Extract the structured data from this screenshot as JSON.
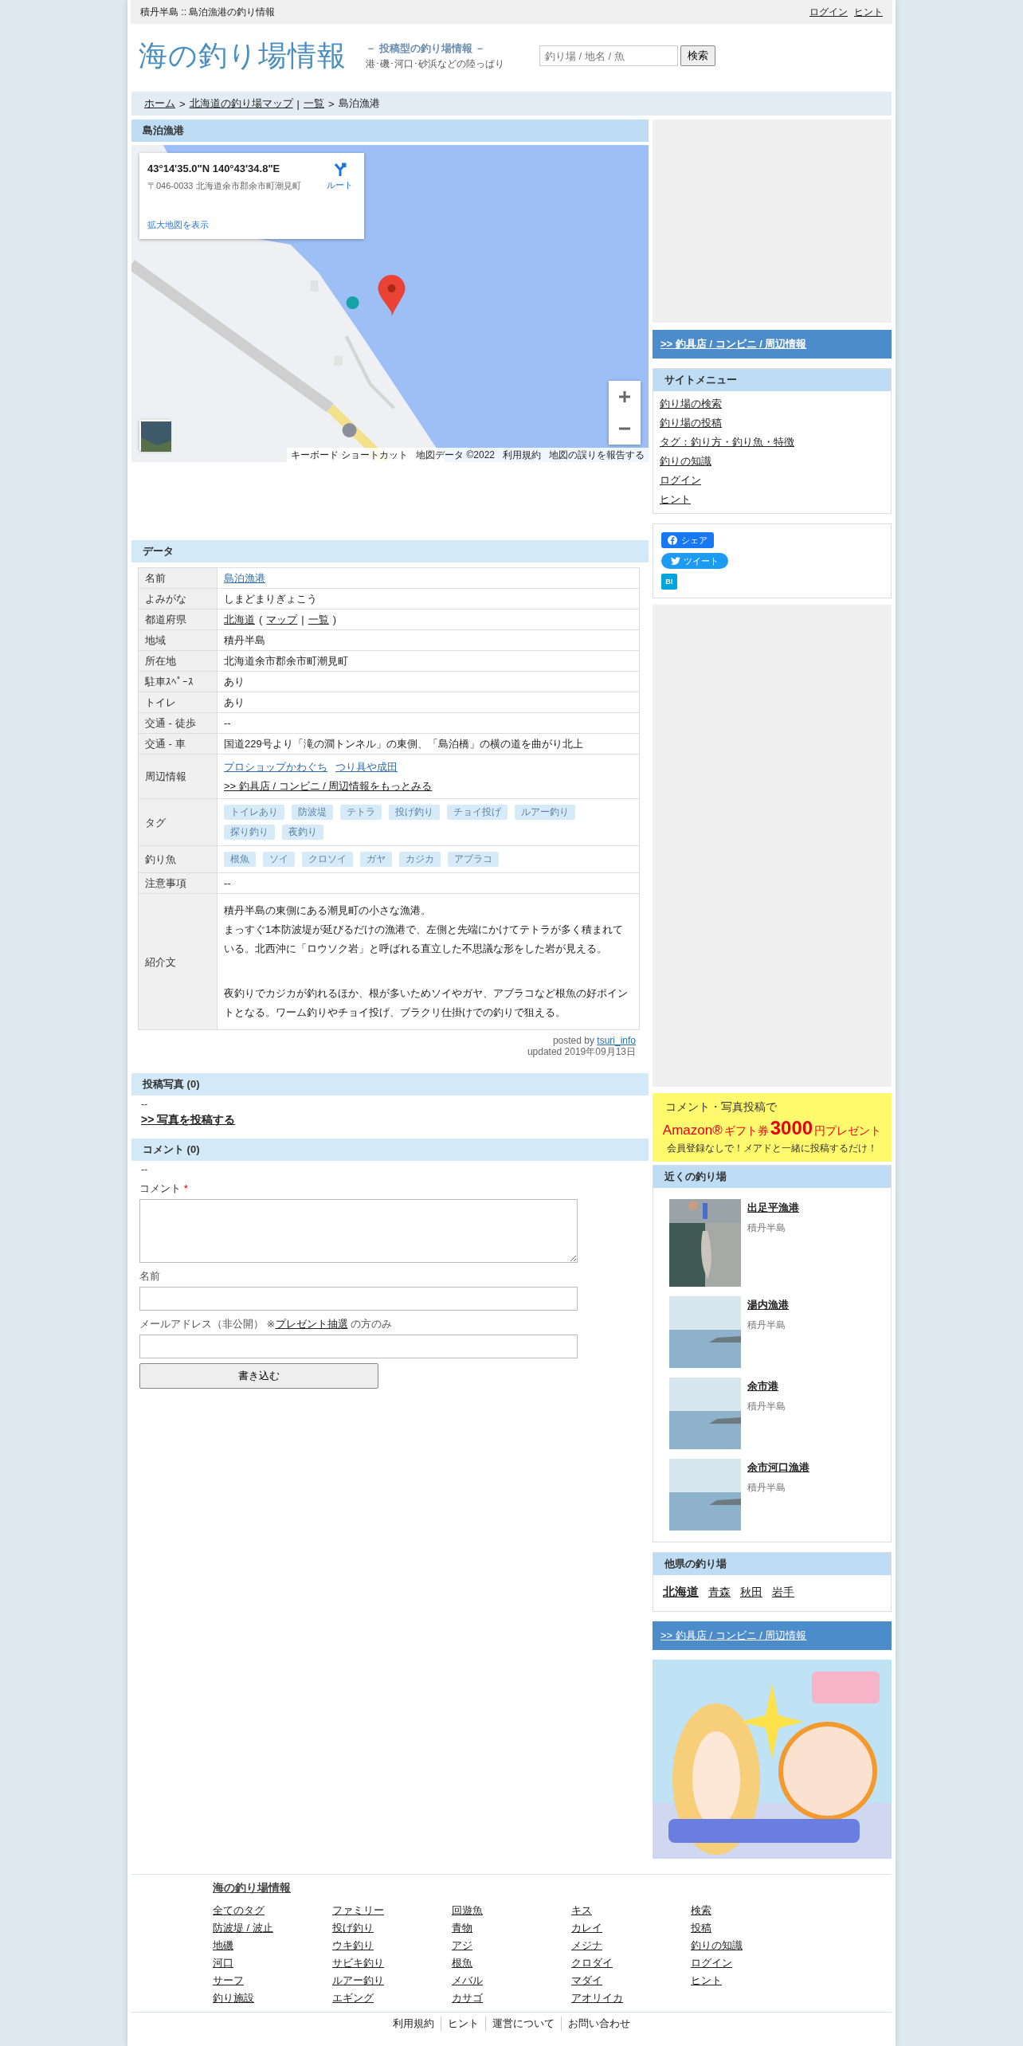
{
  "top_bar": {
    "title": "積丹半島 :: 島泊漁港の釣り情報",
    "links": [
      "ログイン",
      "ヒント"
    ]
  },
  "header": {
    "logo": "海の釣り場情報",
    "tagline": "－ 投稿型の釣り場情報 －",
    "subtagline": "港･磯･河口･砂浜などの陸っぱり",
    "search": {
      "placeholder": "釣り場 / 地名 / 魚",
      "button": "検索"
    }
  },
  "breadcrumb": [
    {
      "text": "ホーム",
      "kind": "link"
    },
    {
      "text": ">",
      "kind": "text"
    },
    {
      "text": "北海道の釣り場マップ",
      "kind": "link"
    },
    {
      "text": "|",
      "kind": "text"
    },
    {
      "text": "一覧",
      "kind": "link"
    },
    {
      "text": ">",
      "kind": "text"
    },
    {
      "text": "島泊漁港",
      "kind": "text"
    }
  ],
  "spot": {
    "title": "島泊漁港",
    "map": {
      "coords": "43°14'35.0\"N 140°43'34.8\"E",
      "address": "〒046-0033 北海道余市郡余市町潮見町",
      "route": "ルート",
      "larger_map": "拡大地図を表示",
      "attribution": [
        "キーボード ショートカット",
        "地図データ ©2022",
        "利用規約",
        "地図の誤りを報告する"
      ]
    }
  },
  "data": {
    "title": "データ",
    "rows": [
      {
        "label": "名前",
        "kind": "parts",
        "parts": [
          {
            "text": "島泊漁港",
            "kind": "bluelink"
          }
        ]
      },
      {
        "label": "よみがな",
        "kind": "text",
        "value": "しまどまりぎょこう"
      },
      {
        "label": "都道府県",
        "kind": "parts",
        "parts": [
          {
            "text": "北海道",
            "kind": "link"
          },
          {
            "text": "(",
            "kind": "text"
          },
          {
            "text": "マップ",
            "kind": "link"
          },
          {
            "text": "|",
            "kind": "text"
          },
          {
            "text": "一覧",
            "kind": "link"
          },
          {
            "text": ")",
            "kind": "text"
          }
        ]
      },
      {
        "label": "地域",
        "kind": "text",
        "value": "積丹半島"
      },
      {
        "label": "所在地",
        "kind": "text",
        "value": "北海道余市郡余市町潮見町"
      },
      {
        "label": "駐車ｽﾍﾟｰｽ",
        "kind": "text",
        "value": "あり"
      },
      {
        "label": "トイレ",
        "kind": "text",
        "value": "あり"
      },
      {
        "label": "交通 - 徒歩",
        "kind": "text",
        "value": "--"
      },
      {
        "label": "交通 - 車",
        "kind": "text",
        "value": "国道229号より「滝の澗トンネル」の東側、「島泊橋」の横の道を曲がり北上"
      },
      {
        "label": "周辺情報",
        "kind": "lines",
        "lines": [
          [
            {
              "text": "プロショップかわぐち",
              "kind": "bluelink"
            },
            {
              "text": "つり具や成田",
              "kind": "bluelink"
            }
          ],
          [
            {
              "text": ">> 釣具店 / コンビニ / 周辺情報をもっとみる",
              "kind": "link"
            }
          ]
        ]
      },
      {
        "label": "タグ",
        "kind": "tags",
        "tags": [
          "トイレあり",
          "防波堤",
          "テトラ",
          "投げ釣り",
          "チョイ投げ",
          "ルアー釣り",
          "探り釣り",
          "夜釣り"
        ]
      },
      {
        "label": "釣り魚",
        "kind": "tags",
        "tags": [
          "根魚",
          "ソイ",
          "クロソイ",
          "ガヤ",
          "カジカ",
          "アブラコ"
        ]
      },
      {
        "label": "注意事項",
        "kind": "text",
        "value": "--"
      },
      {
        "label": "紹介文",
        "kind": "paragraphs",
        "paragraphs": [
          [
            "積丹半島の東側にある潮見町の小さな漁港。",
            "まっすぐ1本防波堤が延びるだけの漁港で、左側と先端にかけてテトラが多く積まれている。北西沖に「ロウソク岩」と呼ばれる直立した不思議な形をした岩が見える。"
          ],
          [
            "夜釣りでカジカが釣れるほか、根が多いためソイやガヤ、アブラコなど根魚の好ポイントとなる。ワーム釣りやチョイ投げ、ブラクリ仕掛けでの釣りで狙える。"
          ]
        ]
      }
    ],
    "posted_by": "posted by",
    "user": "tsuri_info",
    "updated": "updated 2019年09月13日"
  },
  "photos": {
    "title": "投稿写真 (0)",
    "empty": "--",
    "link": ">> 写真を投稿する"
  },
  "comments": {
    "title": "コメント (0)",
    "empty": "--",
    "form": {
      "comment_label": "コメント",
      "required": "*",
      "name_label": "名前",
      "email_before": "メールアドレス（非公開） ※",
      "email_link": "プレゼント抽選",
      "email_after": " の方のみ",
      "submit": "書き込む"
    }
  },
  "sidebar": {
    "nearby_link": ">> 釣具店 / コンビニ / 周辺情報",
    "site_menu": {
      "title": "サイトメニュー",
      "items": [
        "釣り場の検索",
        "釣り場の投稿",
        "タグ：釣り方・釣り魚・特徴",
        "釣りの知識",
        "ログイン",
        "ヒント"
      ]
    },
    "share": {
      "facebook": "シェア",
      "twitter": "ツイート",
      "hatena": "B!"
    },
    "promo": {
      "line1": "コメント・写真投稿で",
      "amazon": "Amazon®",
      "gift": "ギフト券",
      "amount": "3000",
      "yen": "円プレゼント",
      "line3": "会員登録なしで！メアドと一緒に投稿するだけ！"
    },
    "nearby": {
      "title": "近くの釣り場",
      "spots": [
        {
          "name": "出足平漁港",
          "region": "積丹半島"
        },
        {
          "name": "湯内漁港",
          "region": "積丹半島"
        },
        {
          "name": "余市港",
          "region": "積丹半島"
        },
        {
          "name": "余市河口漁港",
          "region": "積丹半島"
        }
      ]
    },
    "other_prefs": {
      "title": "他県の釣り場",
      "items": [
        {
          "text": "北海道",
          "selected": true
        },
        {
          "text": "青森",
          "selected": false
        },
        {
          "text": "秋田",
          "selected": false
        },
        {
          "text": "岩手",
          "selected": false
        }
      ]
    },
    "nearby_link_2": ">> 釣具店 / コンビニ / 周辺情報"
  },
  "footer": {
    "title": "海の釣り場情報",
    "columns": [
      [
        "全てのタグ",
        "防波堤 / 波止",
        "地磯",
        "河口",
        "サーフ",
        "釣り施設"
      ],
      [
        "ファミリー",
        "投げ釣り",
        "ウキ釣り",
        "サビキ釣り",
        "ルアー釣り",
        "エギング"
      ],
      [
        "回遊魚",
        "青物",
        "アジ",
        "根魚",
        "メバル",
        "カサゴ"
      ],
      [
        "キス",
        "カレイ",
        "メジナ",
        "クロダイ",
        "マダイ",
        "アオリイカ"
      ],
      [
        "検索",
        "投稿",
        "釣りの知識",
        "ログイン",
        "ヒント"
      ]
    ],
    "bottom_links": [
      "利用規約",
      "ヒント",
      "運営について",
      "お問い合わせ"
    ]
  }
}
